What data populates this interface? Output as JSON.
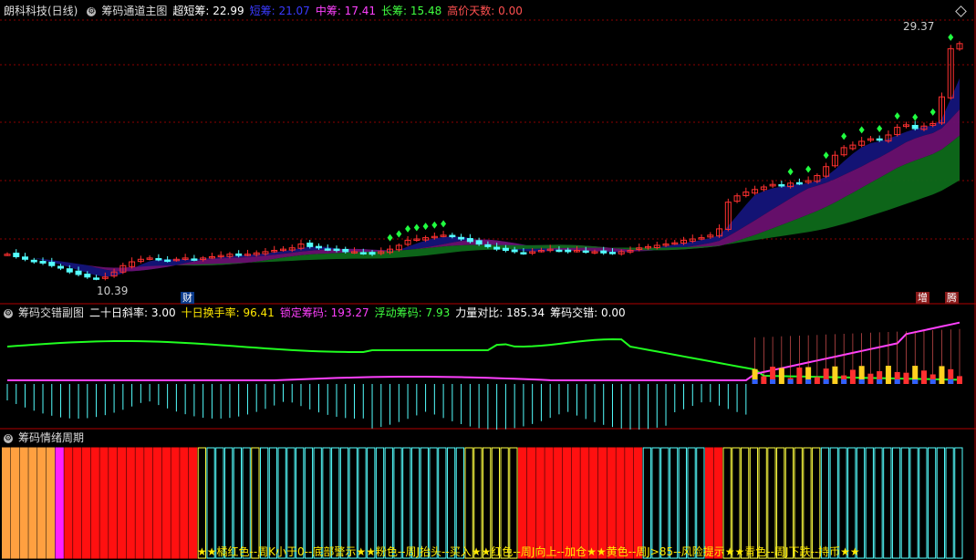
{
  "main_panel": {
    "stock_name": "朗科科技(日线)",
    "indicator_name": "筹码通道主图",
    "labels": [
      {
        "text": "超短筹: 22.99",
        "color": "#ffffff"
      },
      {
        "text": "短筹: 21.07",
        "color": "#3a3aff"
      },
      {
        "text": "中筹: 17.41",
        "color": "#ff40ff"
      },
      {
        "text": "长筹: 15.48",
        "color": "#40ff40"
      },
      {
        "text": "高价天数: 0.00",
        "color": "#ff5050"
      }
    ],
    "high_label": "29.37",
    "low_label": "10.39",
    "tags": {
      "cai": "财",
      "zeng": "增",
      "teng": "腾"
    }
  },
  "sub_panel_1": {
    "indicator_name": "筹码交错副图",
    "labels": [
      {
        "text": "二十日斜率: 3.00",
        "color": "#ffffff"
      },
      {
        "text": "十日换手率: 96.41",
        "color": "#ffe800"
      },
      {
        "text": "锁定筹码: 193.27",
        "color": "#ff40ff"
      },
      {
        "text": "浮动筹码: 7.93",
        "color": "#40ff40"
      },
      {
        "text": "力量对比: 185.34",
        "color": "#ffffff"
      },
      {
        "text": "筹码交错: 0.00",
        "color": "#ffffff"
      }
    ]
  },
  "sub_panel_2": {
    "indicator_name": "筹码情绪周期",
    "legend": "★★橘红色--周K小于0--底部警示★★粉色--周J抬头--买入★★红色--周J向上--加仓★★黄色--周J>85--风险提示★★青色--周J下跌--持币★★"
  },
  "colors": {
    "up": "#ff3030",
    "down": "#54ffff",
    "orange": "#ffa040",
    "pink": "#ff20ff",
    "red": "#ff1010",
    "yellow": "#ffff40",
    "cyan": "#54ffff",
    "green_line": "#20ff20",
    "magenta_line": "#ff40ff",
    "grid": "#8b0000"
  },
  "chart_data": [
    {
      "type": "candlestick",
      "y_range": [
        9,
        31
      ],
      "close_series": [
        12.4,
        12.2,
        12.0,
        11.8,
        11.7,
        11.5,
        11.3,
        11.0,
        10.8,
        10.6,
        10.5,
        10.6,
        11.0,
        11.5,
        11.8,
        12.0,
        12.1,
        12.0,
        11.9,
        12.0,
        12.1,
        12.0,
        12.1,
        12.2,
        12.3,
        12.4,
        12.3,
        12.4,
        12.5,
        12.6,
        12.7,
        12.8,
        12.9,
        13.2,
        13.0,
        12.9,
        12.8,
        12.7,
        12.6,
        12.6,
        12.5,
        12.4,
        12.6,
        12.8,
        13.1,
        13.5,
        13.6,
        13.7,
        13.8,
        13.9,
        13.8,
        13.6,
        13.4,
        13.2,
        13.0,
        12.8,
        12.7,
        12.6,
        12.5,
        12.6,
        12.7,
        12.8,
        12.7,
        12.6,
        12.7,
        12.6,
        12.6,
        12.5,
        12.5,
        12.6,
        12.7,
        12.9,
        13.0,
        13.1,
        13.2,
        13.3,
        13.5,
        13.6,
        13.7,
        13.9,
        14.4,
        16.5,
        17.0,
        17.3,
        17.5,
        17.7,
        17.9,
        17.8,
        18.0,
        18.0,
        18.2,
        18.6,
        19.3,
        20.2,
        20.8,
        21.0,
        21.3,
        21.5,
        21.4,
        21.8,
        22.4,
        22.6,
        22.3,
        22.5,
        22.7,
        24.8,
        28.6,
        29.0
      ],
      "series": [
        "超短筹",
        "短筹",
        "中筹",
        "长筹"
      ]
    },
    {
      "type": "line",
      "series": [
        "浮动筹码",
        "锁定筹码",
        "十日换手率"
      ]
    },
    {
      "type": "bar",
      "category_sequence": "orange x6, pink x1, red x15, yellow x1, cyan x5, yellow x1, cyan x23, yellow x6, red x14, cyan x7, red x2, yellow x11, cyan x16"
    }
  ]
}
